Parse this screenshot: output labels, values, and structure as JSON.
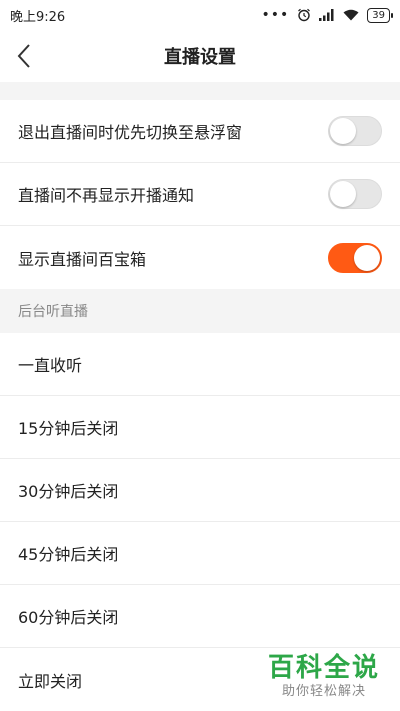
{
  "status_bar": {
    "time": "晚上9:26",
    "dots": "•••",
    "battery": "39"
  },
  "nav": {
    "title": "直播设置"
  },
  "settings": [
    {
      "label": "退出直播间时优先切换至悬浮窗",
      "on": false
    },
    {
      "label": "直播间不再显示开播通知",
      "on": false
    },
    {
      "label": "显示直播间百宝箱",
      "on": true
    }
  ],
  "background_section": {
    "header": "后台听直播",
    "options": [
      "一直收听",
      "15分钟后关闭",
      "30分钟后关闭",
      "45分钟后关闭",
      "60分钟后关闭",
      "立即关闭"
    ]
  },
  "watermark": {
    "title": "百科全说",
    "subtitle": "助你轻松解决"
  },
  "colors": {
    "accent": "#ff5a14",
    "watermark_green": "#2da748"
  }
}
